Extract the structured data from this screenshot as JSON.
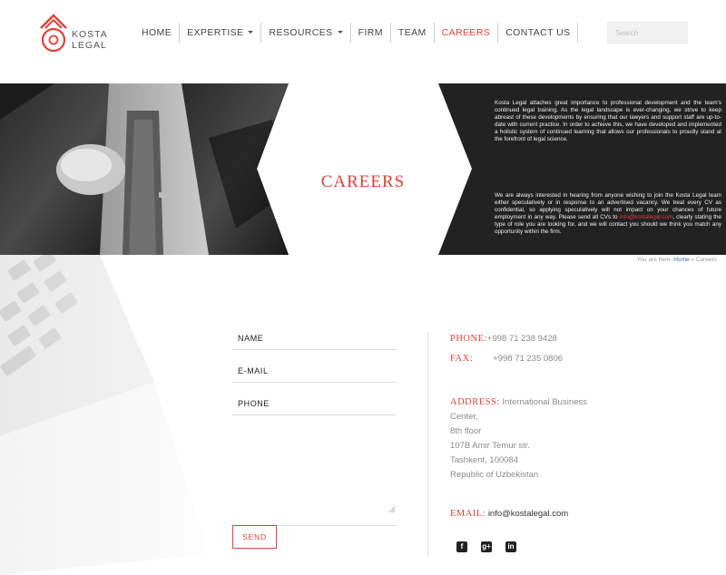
{
  "brand": {
    "line1": "KOSTA",
    "line2": "LEGAL",
    "accent_color": "#e0403a"
  },
  "nav": {
    "items": [
      {
        "label": "HOME",
        "dropdown": false,
        "active": false
      },
      {
        "label": "EXPERTISE",
        "dropdown": true,
        "active": false
      },
      {
        "label": "RESOURCES",
        "dropdown": true,
        "active": false
      },
      {
        "label": "FIRM",
        "dropdown": false,
        "active": false
      },
      {
        "label": "TEAM",
        "dropdown": false,
        "active": false
      },
      {
        "label": "CAREERS",
        "dropdown": false,
        "active": true
      },
      {
        "label": "CONTACT US",
        "dropdown": false,
        "active": false
      }
    ]
  },
  "search": {
    "placeholder": "Search",
    "value": ""
  },
  "banner": {
    "title": "CAREERS",
    "paragraph1": "Kosta Legal attaches great importance to professional development and the team's continued legal training. As the legal landscape is ever-changing, we strive to keep abreast of these developments by ensuring that our lawyers and support staff are up-to-date with current practice. In order to achieve this, we have developed and implemented a holistic system of continued learning that allows our professionals to proudly stand at the forefront of legal science.",
    "paragraph2_before": "We are always interested in hearing from anyone wishing to join the Kosta Legal team either speculatively or in response to an advertised vacancy. We treat every CV as confidential, so applying speculatively will not impact on your chances of future employment in any way. Please send all CVs to ",
    "paragraph2_link": "info@kostalegal.com",
    "paragraph2_after": ", clearly stating the type of role you are looking for, and we will contact you should we think you match any opportunity within the firm."
  },
  "breadcrumb": {
    "prefix": "You are here:",
    "home": "Home",
    "separator": "»",
    "current": "Careers"
  },
  "form": {
    "name_placeholder": "NAME",
    "email_placeholder": "E-MAIL",
    "phone_placeholder": "PHONE",
    "message_value": "",
    "send_label": "SEND"
  },
  "contact": {
    "phone_label": "PHONE:",
    "phone_value": "+998 71 238 9428",
    "fax_label": "FAX:",
    "fax_value": "+998 71 235 0806",
    "address_label": "ADDRESS:",
    "address_lines": [
      "International Business",
      "Center,",
      "8th floor",
      "107B Amir Temur str.",
      "Tashkent, 100084",
      "Republic of Uzbekistan"
    ],
    "email_label": "EMAIL:",
    "email_value": "info@kostalegal.com"
  },
  "social": {
    "facebook_glyph": "f",
    "googleplus_glyph": "g+",
    "linkedin_glyph": "in"
  }
}
